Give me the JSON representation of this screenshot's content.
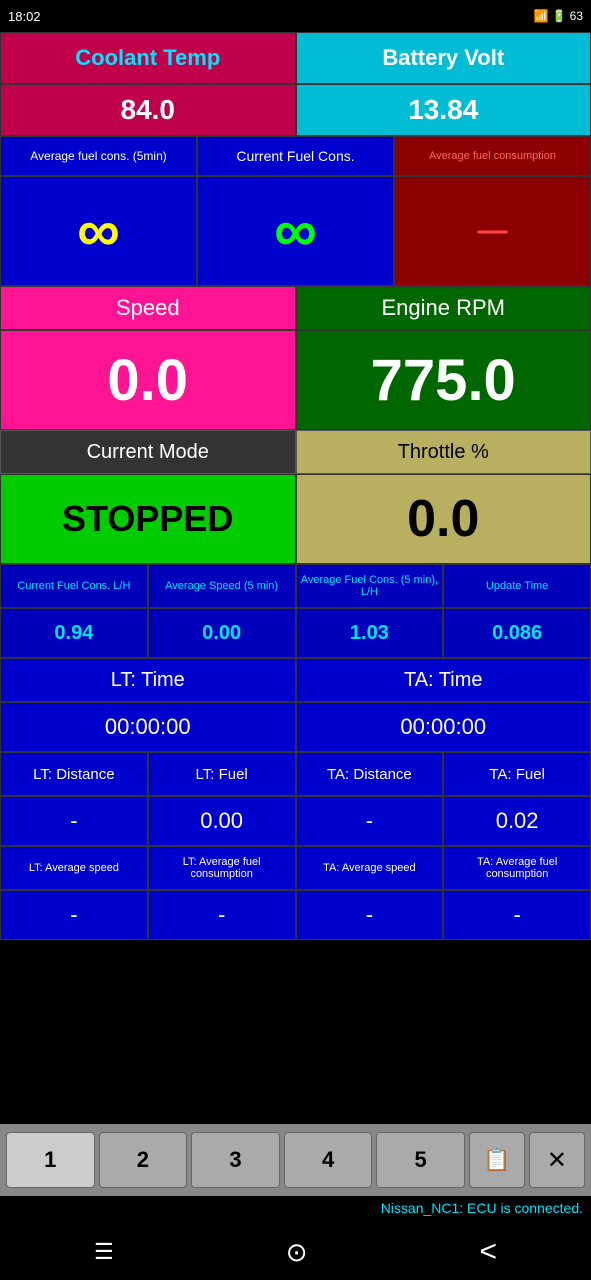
{
  "statusBar": {
    "time": "18:02",
    "batteryLevel": "63"
  },
  "coolant": {
    "label": "Coolant Temp",
    "value": "84.0"
  },
  "battery": {
    "label": "Battery Volt",
    "value": "13.84"
  },
  "fuelCons": {
    "avgLabel": "Average fuel cons. (5min)",
    "curLabel": "Current Fuel Cons.",
    "avgLabel2": "Average fuel consumption"
  },
  "speed": {
    "label": "Speed",
    "value": "0.0"
  },
  "rpm": {
    "label": "Engine RPM",
    "value": "775.0"
  },
  "mode": {
    "label": "Current Mode",
    "value": "STOPPED"
  },
  "throttle": {
    "label": "Throttle %",
    "value": "0.0"
  },
  "stats": {
    "headers": [
      "Current Fuel Cons. L/H",
      "Average Speed (5 min)",
      "Average Fuel Cons. (5 min), L/H",
      "Update Time"
    ],
    "values": [
      "0.94",
      "0.00",
      "1.03",
      "0.086"
    ]
  },
  "ltTime": {
    "label": "LT: Time",
    "value": "00:00:00"
  },
  "taTime": {
    "label": "TA: Time",
    "value": "00:00:00"
  },
  "distance": {
    "lt_dist_label": "LT: Distance",
    "lt_fuel_label": "LT: Fuel",
    "ta_dist_label": "TA: Distance",
    "ta_fuel_label": "TA: Fuel",
    "lt_dist_val": "-",
    "lt_fuel_val": "0.00",
    "ta_dist_val": "-",
    "ta_fuel_val": "0.02"
  },
  "averages": {
    "lt_avg_speed_label": "LT: Average speed",
    "lt_avg_fuel_label": "LT: Average fuel consumption",
    "ta_avg_speed_label": "TA: Average speed",
    "ta_avg_fuel_label": "TA: Average fuel consumption",
    "lt_avg_speed_val": "-",
    "lt_avg_fuel_val": "-",
    "ta_avg_speed_val": "-",
    "ta_avg_fuel_val": "-"
  },
  "tabs": {
    "items": [
      "1",
      "2",
      "3",
      "4",
      "5"
    ],
    "activeIndex": 0
  },
  "statusMsg": "Nissan_NC1: ECU is connected.",
  "nav": {
    "menu": "☰",
    "home": "⌂",
    "back": "‹"
  }
}
